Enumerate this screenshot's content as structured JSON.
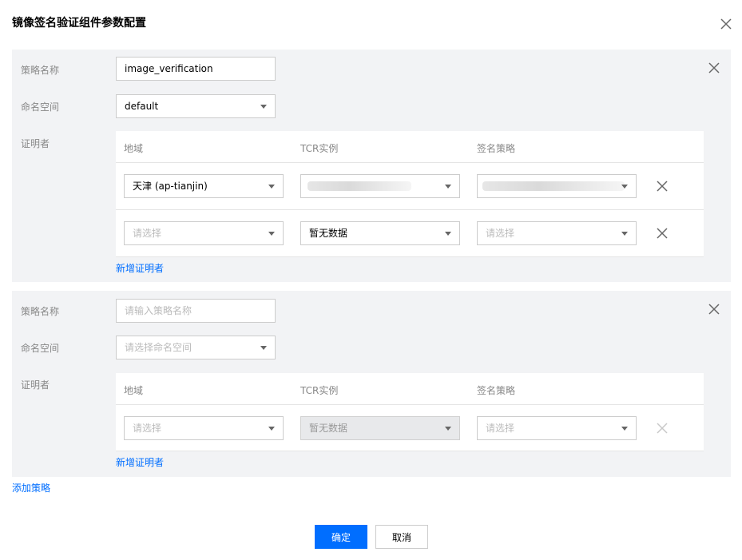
{
  "dialog": {
    "title": "镜像签名验证组件参数配置"
  },
  "labels": {
    "policy_name": "策略名称",
    "namespace": "命名空间",
    "attestor": "证明者"
  },
  "table_headers": [
    "地域",
    "TCR实例",
    "签名策略"
  ],
  "policies": [
    {
      "policy_name_value": "image_verification",
      "namespace_value": "default",
      "rows": [
        {
          "region": "天津 (ap-tianjin)",
          "region_placeholder": false,
          "instance": "",
          "instance_placeholder": false,
          "signature": "",
          "signature_placeholder": false
        },
        {
          "region": "请选择",
          "region_placeholder": true,
          "instance": "暂无数据",
          "instance_placeholder": false,
          "signature": "请选择",
          "signature_placeholder": true
        }
      ],
      "add_attestor": "新增证明者"
    },
    {
      "policy_name_placeholder": "请输入策略名称",
      "namespace_placeholder": "请选择命名空间",
      "rows": [
        {
          "region": "请选择",
          "region_placeholder": true,
          "instance": "暂无数据",
          "instance_disabled": true,
          "signature": "请选择",
          "signature_placeholder": true
        }
      ],
      "add_attestor": "新增证明者"
    }
  ],
  "add_policy": "添加策略",
  "footer": {
    "confirm": "确定",
    "cancel": "取消"
  },
  "colors": {
    "primary": "#006eff",
    "panel_bg": "#f2f3f5",
    "label": "#888888"
  }
}
